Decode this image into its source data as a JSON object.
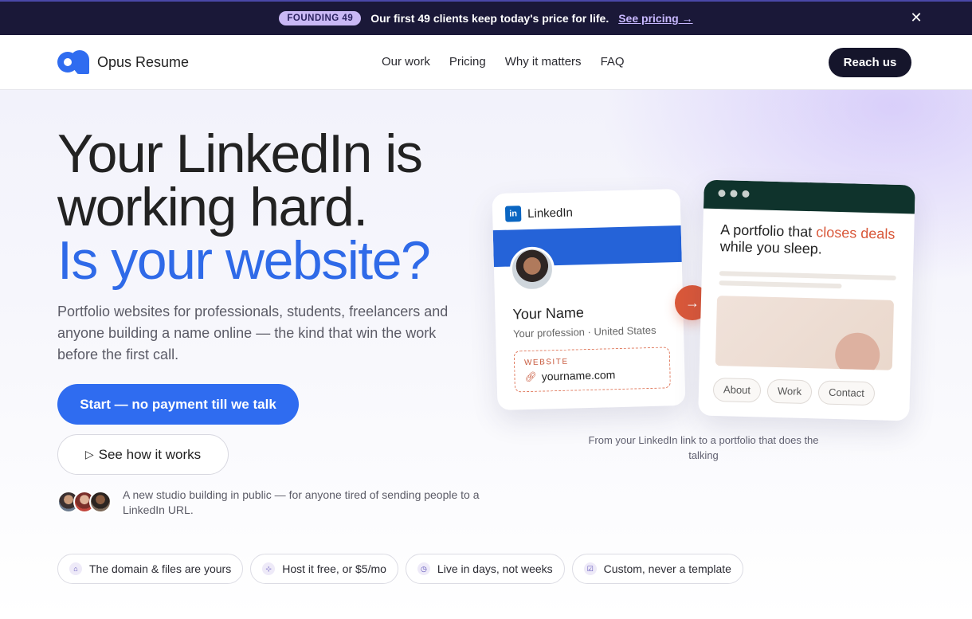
{
  "announcement": {
    "badge": "FOUNDING 49",
    "message": "Our first 49 clients keep today's price for life.",
    "link": "See pricing →",
    "close_icon": "close-icon"
  },
  "nav": {
    "brand": "Opus Resume",
    "links": [
      "Our work",
      "Pricing",
      "Why it matters",
      "FAQ"
    ],
    "cta": "Reach us"
  },
  "hero": {
    "headline_line1": "Your LinkedIn is",
    "headline_line2": "working hard.",
    "headline_accent": "Is your website?",
    "lede": "Portfolio websites for professionals, students, freelancers and anyone building a name online — the kind that win the work before the first call.",
    "primary_cta": "Start — no payment till we talk",
    "secondary_cta": "See how it works",
    "social_proof": "A new studio building in public — for anyone tired of sending people to a LinkedIn URL."
  },
  "features": [
    {
      "icon": "home-icon",
      "label": "The domain & files are yours"
    },
    {
      "icon": "server-icon",
      "label": "Host it free, or $5/mo"
    },
    {
      "icon": "clock-icon",
      "label": "Live in days, not weeks"
    },
    {
      "icon": "check-square-icon",
      "label": "Custom, never a template"
    }
  ],
  "illustration": {
    "linkedin": {
      "header": "LinkedIn",
      "logo_text": "in",
      "name": "Your Name",
      "profession": "Your profession · United States",
      "website_label": "WEBSITE",
      "website_url": "yourname.com"
    },
    "portfolio": {
      "title_pre": "A portfolio that ",
      "title_highlight": "closes deals",
      "title_post": " while you sleep.",
      "pills": [
        "About",
        "Work",
        "Contact"
      ]
    },
    "caption": "From your LinkedIn link to a portfolio that does the talking"
  },
  "colors": {
    "primary": "#2f6cf0",
    "dark": "#15152b",
    "accent_orange": "#d9583a",
    "linkedin_blue": "#0a66c2"
  }
}
